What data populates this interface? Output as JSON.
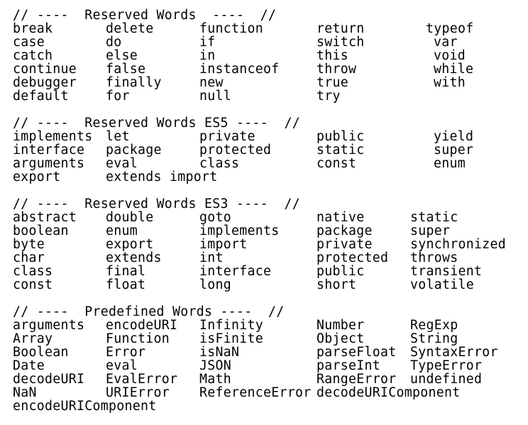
{
  "sections": [
    {
      "header": "// ----  Reserved Words  ----  //",
      "rows": [
        [
          "break",
          "delete",
          "function",
          "return",
          "typeof"
        ],
        [
          "case",
          "do",
          "if",
          "switch",
          "var"
        ],
        [
          "catch",
          "else",
          "in",
          "this",
          "void"
        ],
        [
          "continue",
          "false",
          "instanceof",
          "throw",
          "while"
        ],
        [
          "debugger",
          "finally",
          "new",
          "true",
          "with"
        ],
        [
          "default",
          "for",
          "null",
          "try",
          ""
        ]
      ]
    },
    {
      "header": "// ----  Reserved Words ES5 ----  //",
      "rows": [
        [
          "implements",
          "let",
          "private",
          "public",
          "yield"
        ],
        [
          "interface",
          "package",
          "protected",
          "static",
          "super"
        ],
        [
          "arguments",
          "eval",
          "class",
          "const",
          "enum"
        ],
        [
          "export",
          "extends import",
          "",
          "",
          ""
        ]
      ]
    },
    {
      "header": "// ----  Reserved Words ES3 ----  //",
      "rows": [
        [
          "abstract",
          "double",
          "goto",
          "native",
          "static"
        ],
        [
          "boolean",
          "enum",
          "implements",
          "package",
          "super"
        ],
        [
          "byte",
          "export",
          "import",
          "private",
          "synchronized"
        ],
        [
          "char",
          "extends",
          "int",
          "protected",
          "throws"
        ],
        [
          "class",
          "final",
          "interface",
          "public",
          "transient"
        ],
        [
          "const",
          "float",
          "long",
          "short",
          "volatile"
        ]
      ]
    },
    {
      "header": "// ----  Predefined Words ----  //",
      "rows": [
        [
          "arguments",
          "encodeURI",
          "Infinity",
          "Number",
          "RegExp"
        ],
        [
          "Array",
          "Function",
          "isFinite",
          "Object",
          "String"
        ],
        [
          "Boolean",
          "Error",
          "isNaN",
          "parseFloat",
          "SyntaxError"
        ],
        [
          "Date",
          "eval",
          "JSON",
          "parseInt",
          "TypeError"
        ],
        [
          "decodeURI",
          "EvalError",
          "Math",
          "RangeError",
          "undefined"
        ],
        [
          "NaN",
          "URIError",
          "ReferenceError",
          "decodeURIComponent",
          ""
        ],
        [
          "encodeURIComponent",
          "",
          "",
          "",
          ""
        ]
      ]
    }
  ]
}
